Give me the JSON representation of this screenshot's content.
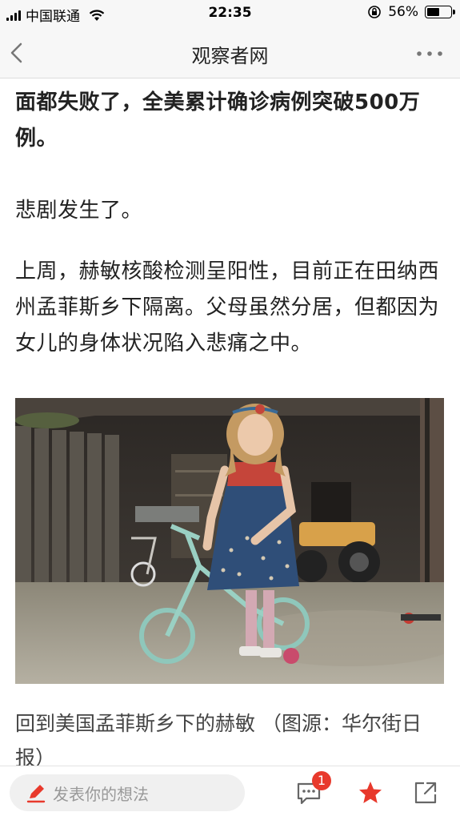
{
  "status_bar": {
    "carrier": "中国联通",
    "time": "22:35",
    "battery_percent": "56%",
    "battery_level": 0.56
  },
  "nav": {
    "title": "观察者网"
  },
  "article": {
    "para1": "面都失败了，全美累计确诊病例突破500万例。",
    "para2": "悲剧发生了。",
    "para3": "上周，赫敏核酸检测呈阳性，目前正在田纳西州孟菲斯乡下隔离。父母虽然分居，但都因为女儿的身体状况陷入悲痛之中。",
    "caption": "回到美国孟菲斯乡下的赫敏 （图源：华尔街日报）"
  },
  "bottom_bar": {
    "comment_placeholder": "发表你的想法",
    "comment_count": "1"
  },
  "colors": {
    "accent_red": "#e8392c",
    "text": "#222222"
  }
}
